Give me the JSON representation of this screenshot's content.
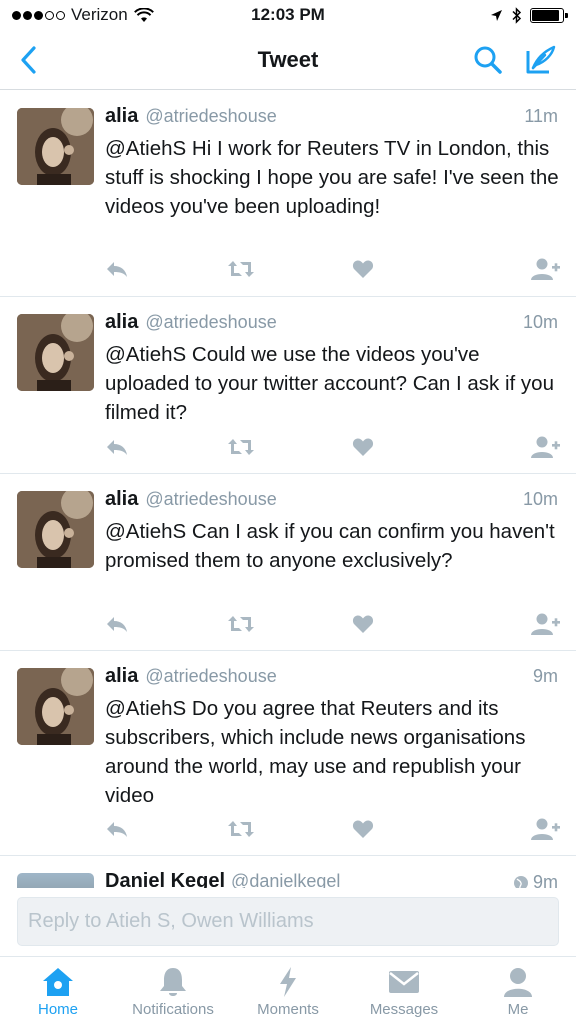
{
  "status_bar": {
    "carrier": "Verizon",
    "time": "12:03 PM",
    "battery_level": 0.9
  },
  "header": {
    "title": "Tweet"
  },
  "tweets": [
    {
      "name": "alia",
      "handle": "@atriedeshouse",
      "time": "11m",
      "text": "@AtiehS Hi I work for Reuters TV in London, this stuff is shocking I hope you are safe! I've seen the videos you've been uploading!"
    },
    {
      "name": "alia",
      "handle": "@atriedeshouse",
      "time": "10m",
      "text": "@AtiehS Could we use the videos you've uploaded to your twitter account? Can I ask if you filmed it?"
    },
    {
      "name": "alia",
      "handle": "@atriedeshouse",
      "time": "10m",
      "text": "@AtiehS Can I ask if you can confirm you haven't promised them to anyone exclusively?"
    },
    {
      "name": "alia",
      "handle": "@atriedeshouse",
      "time": "9m",
      "text": "@AtiehS Do you agree that Reuters and its subscribers, which include news organisations around the world, may use and republish your video"
    }
  ],
  "partial_tweet": {
    "name": "Daniel Kegel",
    "handle": "@danielkegel",
    "time": "9m"
  },
  "reply": {
    "placeholder": "Reply to Atieh S, Owen Williams"
  },
  "tabs": [
    {
      "label": "Home",
      "icon": "home-icon",
      "active": true
    },
    {
      "label": "Notifications",
      "icon": "bell-icon",
      "active": false
    },
    {
      "label": "Moments",
      "icon": "lightning-icon",
      "active": false
    },
    {
      "label": "Messages",
      "icon": "envelope-icon",
      "active": false
    },
    {
      "label": "Me",
      "icon": "person-icon",
      "active": false
    }
  ],
  "colors": {
    "accent": "#1da1f2",
    "icon_gray": "#aab8c2",
    "secondary_text": "#8899a6"
  }
}
